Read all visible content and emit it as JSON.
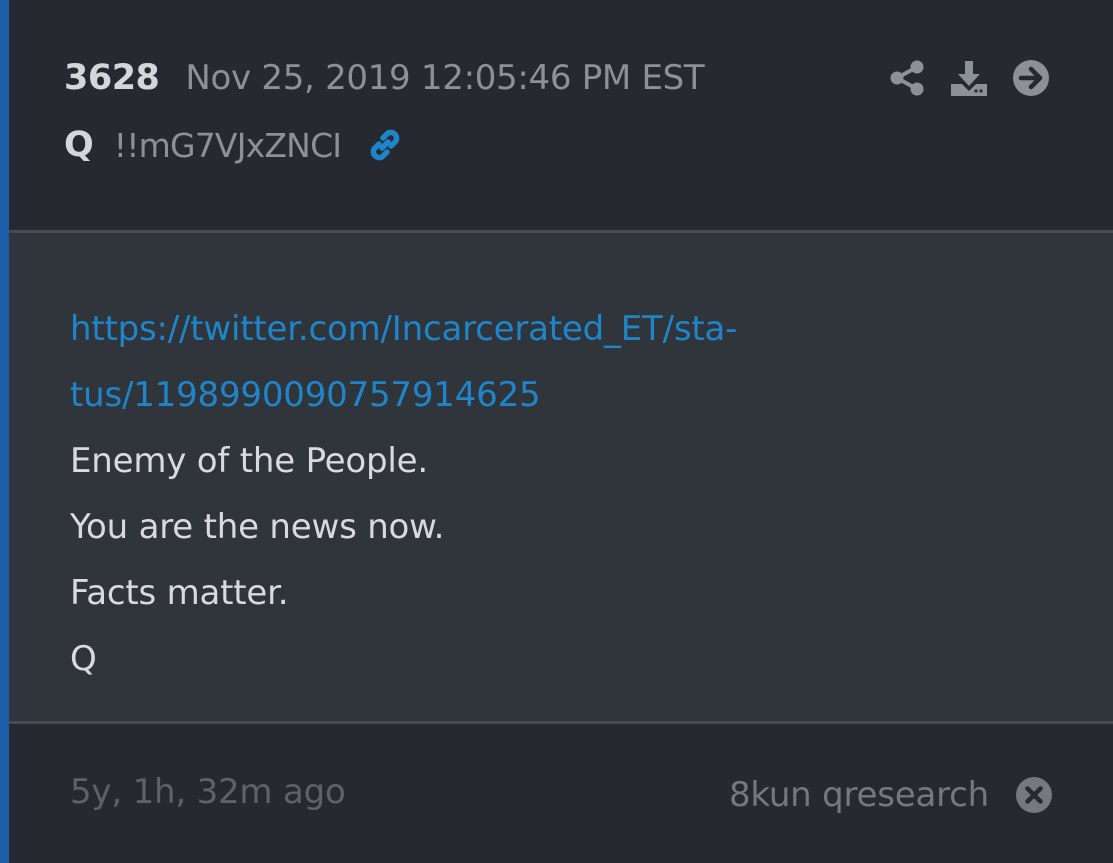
{
  "post": {
    "number": "3628",
    "date": "Nov 25, 2019 12:05:46 PM EST",
    "author": "Q",
    "tripcode": "!!mG7VJxZNCI",
    "link_icon": "link-icon",
    "actions": [
      {
        "name": "share-icon"
      },
      {
        "name": "download-icon"
      },
      {
        "name": "arrow-right-circle-icon"
      }
    ],
    "body": {
      "link_line1": "https://twitter.com/Incarcerated_ET/sta-",
      "link_line2": "tus/1198990090757914625",
      "lines": [
        "Enemy of the People.",
        "You are the news now.",
        "Facts matter.",
        "Q"
      ]
    },
    "footer": {
      "ago": "5y, 1h, 32m ago",
      "source": "8kun qresearch",
      "close_icon": "close-icon"
    }
  },
  "colors": {
    "accent_bar": "#1d5ea8",
    "link": "#1e86c8",
    "header_bg": "#26292f",
    "body_bg": "#30343b"
  }
}
